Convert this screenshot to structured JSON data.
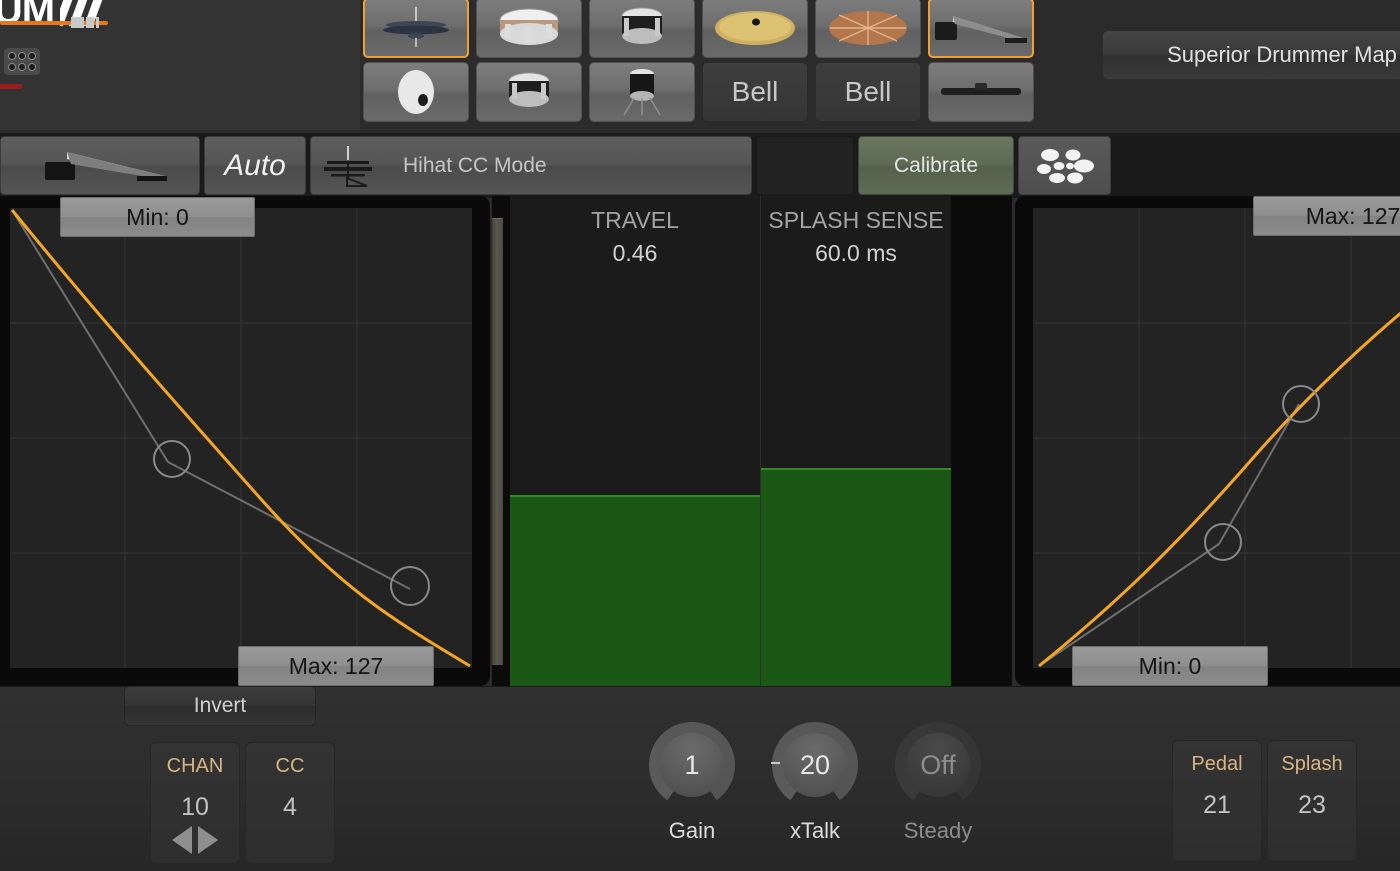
{
  "brand": {
    "logo_text": "RUM",
    "logo_mark": "three-slashes",
    "load_bar_percent": 100
  },
  "header": {
    "map_button_label": "Superior Drummer Map"
  },
  "instruments": {
    "row1": [
      {
        "name": "hihat",
        "icon": "hihat-icon",
        "label": "",
        "selected": true,
        "dark": false
      },
      {
        "name": "snare",
        "icon": "snare-drum-icon",
        "label": "",
        "selected": false,
        "dark": false
      },
      {
        "name": "tom",
        "icon": "tom-drum-icon",
        "label": "",
        "selected": false,
        "dark": false
      },
      {
        "name": "ride",
        "icon": "ride-cymbal-icon",
        "label": "",
        "selected": false,
        "dark": false
      },
      {
        "name": "crash",
        "icon": "crash-cymbal-icon",
        "label": "",
        "selected": false,
        "dark": false
      },
      {
        "name": "hihat-pedal",
        "icon": "hihat-pedal-icon",
        "label": "",
        "selected": true,
        "dark": false
      }
    ],
    "row2": [
      {
        "name": "kick",
        "icon": "kick-pad-icon",
        "label": "",
        "selected": false,
        "dark": false
      },
      {
        "name": "floor-tom",
        "icon": "floor-tom-icon",
        "label": "",
        "selected": false,
        "dark": false
      },
      {
        "name": "standing-tom",
        "icon": "standing-tom-icon",
        "label": "",
        "selected": false,
        "dark": false
      },
      {
        "name": "bell-1",
        "icon": "",
        "label": "Bell",
        "selected": false,
        "dark": true
      },
      {
        "name": "bell-2",
        "icon": "",
        "label": "Bell",
        "selected": false,
        "dark": true
      },
      {
        "name": "bar-trigger",
        "icon": "bar-trigger-icon",
        "label": "",
        "selected": false,
        "dark": false
      }
    ]
  },
  "toolbar": {
    "pedal_icon": "hihat-pedal-icon",
    "auto_label": "Auto",
    "mode_icon": "hihat-stand-icon",
    "mode_label": "Hihat CC Mode",
    "calibrate_label": "Calibrate",
    "pads_icon": "drum-pads-icon"
  },
  "chart_data": [
    {
      "type": "line",
      "name": "pedal-response-curve-left",
      "title": "",
      "xlabel": "",
      "ylabel": "",
      "xlim": [
        0,
        1
      ],
      "ylim": [
        0,
        127
      ],
      "grid": true,
      "grid_cols": 4,
      "grid_rows": 4,
      "inverted": true,
      "min_label": "Min: 0",
      "max_label": "Max: 127",
      "min_value": 0,
      "max_value": 127,
      "curve_color": "#f5a623",
      "handle": {
        "x": 0.34,
        "y": 0.55
      },
      "points": [
        {
          "x": 0.0,
          "y": 127
        },
        {
          "x": 0.12,
          "y": 112
        },
        {
          "x": 0.25,
          "y": 96
        },
        {
          "x": 0.4,
          "y": 76
        },
        {
          "x": 0.55,
          "y": 56
        },
        {
          "x": 0.7,
          "y": 37
        },
        {
          "x": 0.85,
          "y": 18
        },
        {
          "x": 1.0,
          "y": 0
        }
      ]
    },
    {
      "type": "line",
      "name": "pedal-response-curve-right",
      "title": "",
      "xlabel": "",
      "ylabel": "",
      "xlim": [
        0,
        1
      ],
      "ylim": [
        0,
        127
      ],
      "grid": true,
      "grid_cols": 4,
      "grid_rows": 4,
      "inverted": false,
      "min_label": "Min: 0",
      "max_label": "Max: 127",
      "min_value": 0,
      "max_value": 127,
      "curve_color": "#f5a623",
      "handle": {
        "x": 0.58,
        "y": 0.42
      },
      "points": [
        {
          "x": 0.0,
          "y": 0
        },
        {
          "x": 0.15,
          "y": 20
        },
        {
          "x": 0.3,
          "y": 42
        },
        {
          "x": 0.45,
          "y": 62
        },
        {
          "x": 0.6,
          "y": 82
        },
        {
          "x": 0.75,
          "y": 100
        },
        {
          "x": 0.9,
          "y": 117
        },
        {
          "x": 1.0,
          "y": 127
        }
      ]
    },
    {
      "type": "bar",
      "name": "meters",
      "title": "",
      "categories": [
        "TRAVEL",
        "SPLASH SENSE"
      ],
      "value_labels": [
        "0.46",
        "60.0 ms"
      ],
      "values": [
        0.385,
        0.441
      ],
      "ylim": [
        0,
        1
      ],
      "bar_color": "#1b5715",
      "grid": false
    }
  ],
  "meters": {
    "travel": {
      "title": "TRAVEL",
      "value": "0.46"
    },
    "splash": {
      "title": "SPLASH SENSE",
      "value": "60.0 ms"
    }
  },
  "curves": {
    "left": {
      "min_label": "Min: 0",
      "max_label": "Max: 127"
    },
    "right": {
      "min_label": "Max: 127",
      "max_label": "Min: 0"
    }
  },
  "bottom": {
    "invert_label": "Invert",
    "slots": [
      {
        "name": "chan",
        "label": "CHAN",
        "value": "10",
        "arrows": true
      },
      {
        "name": "cc",
        "label": "CC",
        "value": "4",
        "arrows": false
      },
      {
        "name": "pedal",
        "label": "Pedal",
        "value": "21",
        "arrows": false
      },
      {
        "name": "splash",
        "label": "Splash",
        "value": "23",
        "arrows": false
      }
    ],
    "knobs": [
      {
        "name": "gain",
        "value": "1",
        "label": "Gain",
        "disabled": false
      },
      {
        "name": "xtalk",
        "value": "20",
        "label": "xTalk",
        "disabled": false
      },
      {
        "name": "steady",
        "value": "Off",
        "label": "Steady",
        "disabled": true
      }
    ]
  },
  "colors": {
    "accent_orange": "#f5a623",
    "brand_orange": "#e8761a",
    "meter_green": "#1b5715",
    "calibrate_green": "#5d6a54",
    "slot_label_tan": "#d7b580"
  }
}
